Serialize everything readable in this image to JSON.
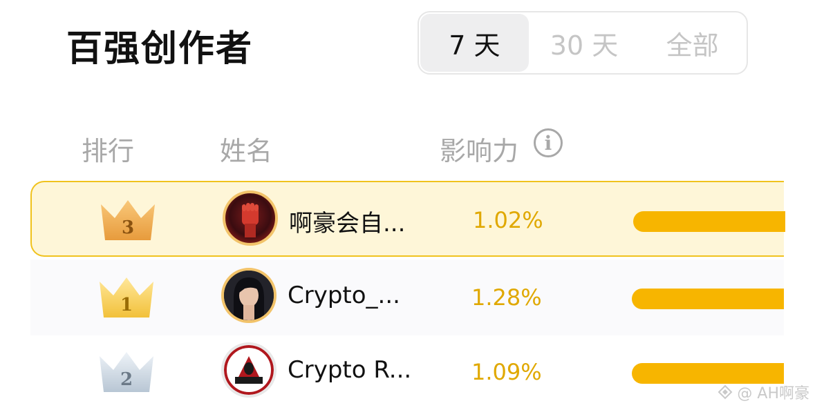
{
  "header": {
    "title": "百强创作者"
  },
  "period_tabs": [
    {
      "label": "7 天",
      "active": true
    },
    {
      "label": "30 天",
      "active": false
    },
    {
      "label": "全部",
      "active": false
    }
  ],
  "columns": {
    "rank": "排行",
    "name": "姓名",
    "influence": "影响力",
    "info_icon": "i"
  },
  "rows": [
    {
      "rank": "3",
      "name": "啊豪会自...",
      "influence": "1.02%",
      "crown": "bronze",
      "highlighted": true
    },
    {
      "rank": "1",
      "name": "Crypto_...",
      "influence": "1.28%",
      "crown": "gold",
      "highlighted": false
    },
    {
      "rank": "2",
      "name": "Crypto R...",
      "influence": "1.09%",
      "crown": "silver",
      "highlighted": false
    }
  ],
  "watermark": {
    "text": "@ AH啊豪"
  },
  "colors": {
    "accent": "#f7b500",
    "percent_text": "#e0a800",
    "highlight_bg": "#fef6d8",
    "highlight_border": "#f0c21d"
  }
}
